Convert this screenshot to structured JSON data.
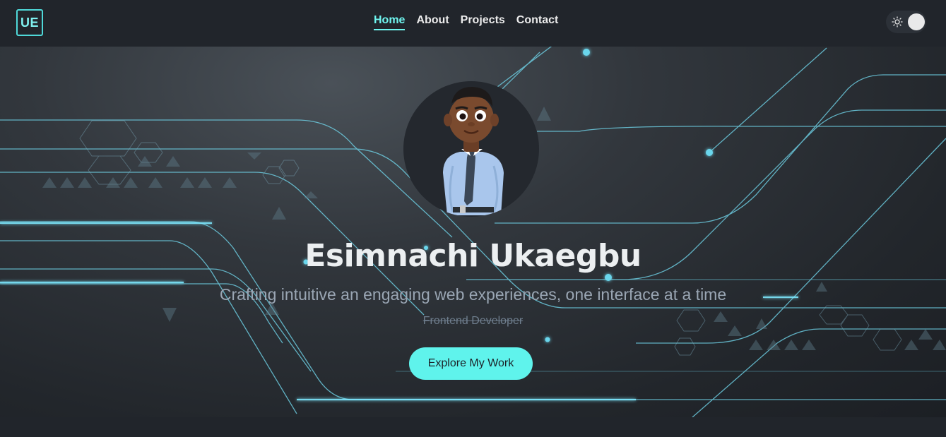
{
  "header": {
    "logo_text": "UE",
    "nav": [
      {
        "label": "Home",
        "active": true
      },
      {
        "label": "About",
        "active": false
      },
      {
        "label": "Projects",
        "active": false
      },
      {
        "label": "Contact",
        "active": false
      }
    ],
    "theme_toggle": {
      "icon": "sun-icon",
      "state": "light"
    }
  },
  "hero": {
    "avatar_icon": "3d-avatar-icon",
    "name": "Esimnachi Ukaegbu",
    "tagline": "Crafting intuitive an engaging web experiences, one interface at a time",
    "role": "Frontend Developer",
    "cta_label": "Explore My Work"
  },
  "colors": {
    "accent": "#5ff3ec",
    "background": "#21252b",
    "nav_text": "#ececec",
    "active_nav": "#6ff5ef"
  }
}
